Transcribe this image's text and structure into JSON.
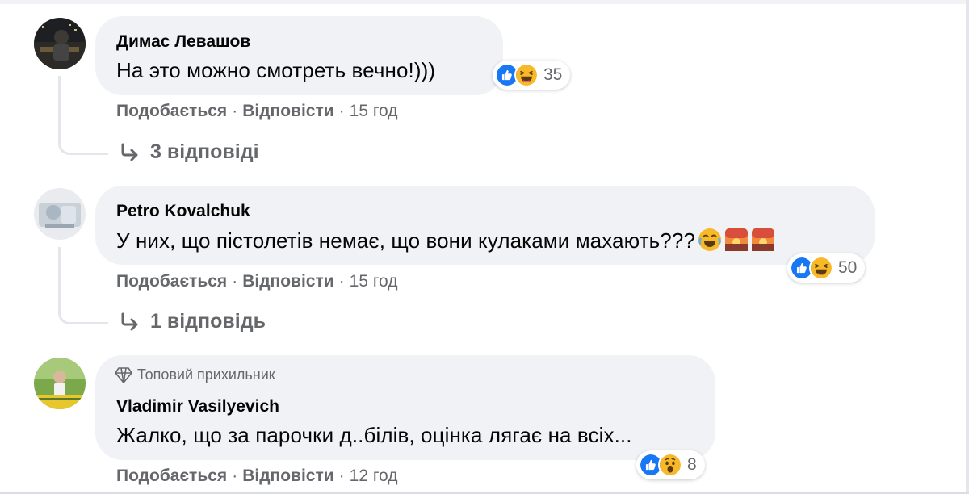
{
  "comments": [
    {
      "author": "Димас Левашов",
      "text": "На это можно смотреть вечно!)))",
      "reactions": {
        "icons": [
          "like-icon",
          "haha-icon"
        ],
        "count": "35"
      },
      "actions": {
        "like": "Подобається",
        "reply": "Відповісти",
        "time": "15 год"
      },
      "replies_label": "3 відповіді"
    },
    {
      "author": "Petro Kovalchuk",
      "text": "У них, що пістолетів немає, що вони кулаками махають???",
      "text_emojis": [
        "joy-emoji-icon",
        "sunset-emoji-icon",
        "sunset-emoji-icon"
      ],
      "reactions": {
        "icons": [
          "like-icon",
          "haha-icon"
        ],
        "count": "50"
      },
      "actions": {
        "like": "Подобається",
        "reply": "Відповісти",
        "time": "15 год"
      },
      "replies_label": "1 відповідь"
    },
    {
      "badge": {
        "icon": "diamond-icon",
        "label": "Топовий прихильник"
      },
      "author": "Vladimir Vasilyevich",
      "text": "Жалко, що за парочки д..білів, оцінка лягає на всіх...",
      "reactions": {
        "icons": [
          "like-icon",
          "wow-icon"
        ],
        "count": "8"
      },
      "actions": {
        "like": "Подобається",
        "reply": "Відповісти",
        "time": "12 год"
      }
    }
  ],
  "sep": "·",
  "colors": {
    "bubble": "#f0f2f5",
    "secondary_text": "#65676b",
    "like_blue": "#1877f2",
    "reaction_yellow": "#f7b928"
  }
}
